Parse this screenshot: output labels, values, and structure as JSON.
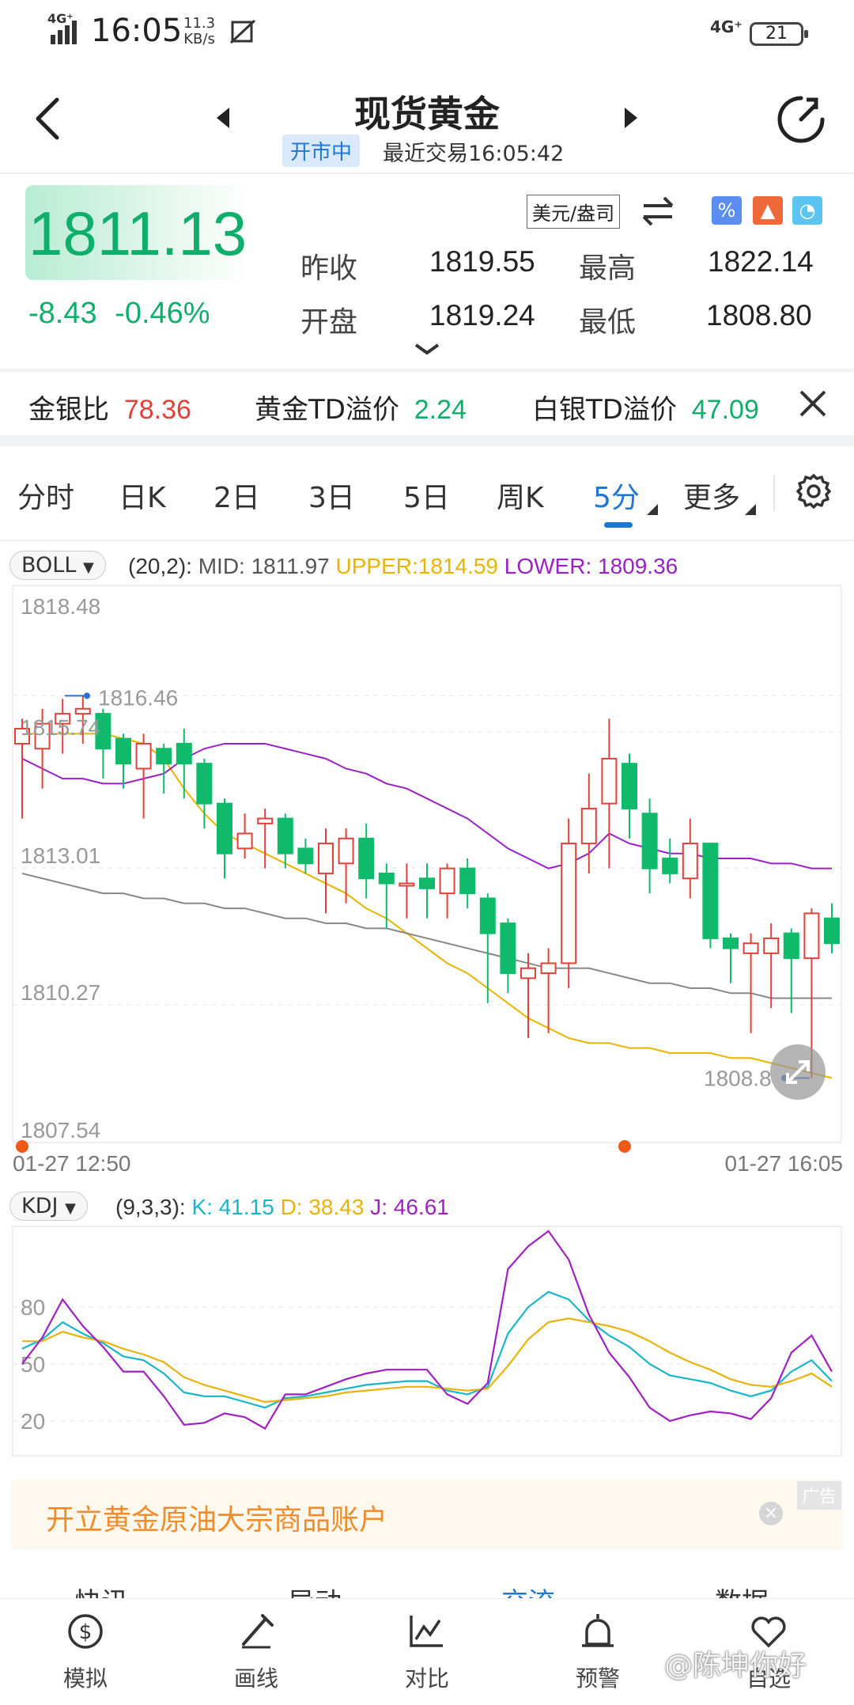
{
  "status_bar": {
    "network_left": "4G⁺",
    "time": "16:05",
    "speed_value": "11.3",
    "speed_unit": "KB/s",
    "network_right": "4G⁺",
    "battery": "21"
  },
  "header": {
    "title": "现货黄金",
    "status_badge": "开市中",
    "last_trade": "最近交易16:05:42"
  },
  "quote": {
    "price": "1811.13",
    "change": "-8.43",
    "change_pct": "-0.46%",
    "currency": "美元/盎司",
    "prev_close_label": "昨收",
    "prev_close": "1819.55",
    "high_label": "最高",
    "high": "1822.14",
    "open_label": "开盘",
    "open": "1819.24",
    "low_label": "最低",
    "low": "1808.80"
  },
  "ratios": [
    {
      "label": "金银比",
      "value": "78.36",
      "color": "#e0423a"
    },
    {
      "label": "黄金TD溢价",
      "value": "2.24",
      "color": "#0fae6a"
    },
    {
      "label": "白银TD溢价",
      "value": "47.09",
      "color": "#0fae6a"
    }
  ],
  "tabs": [
    "分时",
    "日K",
    "2日",
    "3日",
    "5日",
    "周K",
    "5分",
    "更多"
  ],
  "active_tab": "5分",
  "boll": {
    "name": "BOLL",
    "params": "(20,2):",
    "mid": "MID: 1811.97",
    "upper": "UPPER:1814.59",
    "lower": "LOWER: 1809.36"
  },
  "kdj": {
    "name": "KDJ",
    "params": "(9,3,3):",
    "k": "K: 41.15",
    "d": "D: 38.43",
    "j": "J: 46.61"
  },
  "colors": {
    "up": "#e0423a",
    "down": "#0fba6a",
    "upper": "#e9b400",
    "lower": "#9b20c8",
    "mid": "#888888",
    "k": "#1ab5c8",
    "d": "#e8b30c",
    "j": "#a020c0"
  },
  "chart_data": [
    {
      "type": "candlestick",
      "title": "",
      "y_ticks": [
        "1818.48",
        "1813.01",
        "1810.27",
        "1807.54"
      ],
      "ylim": [
        1807.54,
        1818.48
      ],
      "x_labels": [
        "01-27 12:50",
        "01-27 16:05"
      ],
      "annotations": [
        "1816.46",
        "1815.74",
        "1808.8"
      ],
      "candles": [
        {
          "o": 1815.5,
          "h": 1816.0,
          "l": 1814.0,
          "c": 1815.8
        },
        {
          "o": 1815.4,
          "h": 1816.2,
          "l": 1814.6,
          "c": 1815.9
        },
        {
          "o": 1815.9,
          "h": 1816.4,
          "l": 1815.3,
          "c": 1816.1
        },
        {
          "o": 1816.1,
          "h": 1816.46,
          "l": 1815.5,
          "c": 1816.2
        },
        {
          "o": 1816.1,
          "h": 1816.2,
          "l": 1814.8,
          "c": 1815.4
        },
        {
          "o": 1815.6,
          "h": 1815.7,
          "l": 1814.6,
          "c": 1815.1
        },
        {
          "o": 1815.0,
          "h": 1815.7,
          "l": 1814.0,
          "c": 1815.5
        },
        {
          "o": 1815.4,
          "h": 1815.5,
          "l": 1814.5,
          "c": 1815.1
        },
        {
          "o": 1815.5,
          "h": 1815.8,
          "l": 1814.4,
          "c": 1815.1
        },
        {
          "o": 1815.1,
          "h": 1815.2,
          "l": 1813.8,
          "c": 1814.3
        },
        {
          "o": 1814.3,
          "h": 1814.4,
          "l": 1812.8,
          "c": 1813.3
        },
        {
          "o": 1813.4,
          "h": 1814.1,
          "l": 1813.2,
          "c": 1813.7
        },
        {
          "o": 1813.9,
          "h": 1814.2,
          "l": 1813.0,
          "c": 1814.0
        },
        {
          "o": 1814.0,
          "h": 1814.1,
          "l": 1813.0,
          "c": 1813.3
        },
        {
          "o": 1813.4,
          "h": 1813.6,
          "l": 1812.9,
          "c": 1813.1
        },
        {
          "o": 1812.9,
          "h": 1813.8,
          "l": 1812.1,
          "c": 1813.5
        },
        {
          "o": 1813.1,
          "h": 1813.8,
          "l": 1812.3,
          "c": 1813.6
        },
        {
          "o": 1813.6,
          "h": 1813.9,
          "l": 1812.4,
          "c": 1812.8
        },
        {
          "o": 1812.9,
          "h": 1813.1,
          "l": 1811.8,
          "c": 1812.7
        },
        {
          "o": 1812.7,
          "h": 1813.1,
          "l": 1812.0,
          "c": 1812.7
        },
        {
          "o": 1812.8,
          "h": 1813.1,
          "l": 1812.0,
          "c": 1812.6
        },
        {
          "o": 1812.5,
          "h": 1813.1,
          "l": 1812.0,
          "c": 1813.0
        },
        {
          "o": 1813.0,
          "h": 1813.2,
          "l": 1812.2,
          "c": 1812.5
        },
        {
          "o": 1812.4,
          "h": 1812.5,
          "l": 1810.3,
          "c": 1811.7
        },
        {
          "o": 1811.9,
          "h": 1812.0,
          "l": 1810.5,
          "c": 1810.9
        },
        {
          "o": 1810.8,
          "h": 1811.3,
          "l": 1809.6,
          "c": 1811.0
        },
        {
          "o": 1810.9,
          "h": 1811.4,
          "l": 1809.7,
          "c": 1811.1
        },
        {
          "o": 1811.1,
          "h": 1814.0,
          "l": 1810.6,
          "c": 1813.5
        },
        {
          "o": 1813.5,
          "h": 1814.9,
          "l": 1812.9,
          "c": 1814.2
        },
        {
          "o": 1814.3,
          "h": 1816.0,
          "l": 1813.0,
          "c": 1815.2
        },
        {
          "o": 1815.1,
          "h": 1815.3,
          "l": 1813.6,
          "c": 1814.2
        },
        {
          "o": 1814.1,
          "h": 1814.4,
          "l": 1812.5,
          "c": 1813.0
        },
        {
          "o": 1813.2,
          "h": 1813.6,
          "l": 1812.7,
          "c": 1812.9
        },
        {
          "o": 1812.8,
          "h": 1814.0,
          "l": 1812.4,
          "c": 1813.5
        },
        {
          "o": 1813.5,
          "h": 1813.5,
          "l": 1811.4,
          "c": 1811.6
        },
        {
          "o": 1811.6,
          "h": 1811.7,
          "l": 1810.7,
          "c": 1811.4
        },
        {
          "o": 1811.3,
          "h": 1811.7,
          "l": 1809.7,
          "c": 1811.5
        },
        {
          "o": 1811.3,
          "h": 1811.9,
          "l": 1810.2,
          "c": 1811.6
        },
        {
          "o": 1811.7,
          "h": 1811.8,
          "l": 1810.1,
          "c": 1811.2
        },
        {
          "o": 1811.2,
          "h": 1812.2,
          "l": 1808.8,
          "c": 1812.1
        },
        {
          "o": 1812.0,
          "h": 1812.3,
          "l": 1811.3,
          "c": 1811.5
        }
      ],
      "upper": [
        1815.2,
        1815.0,
        1814.8,
        1814.8,
        1814.7,
        1814.7,
        1814.8,
        1814.9,
        1815.2,
        1815.4,
        1815.5,
        1815.5,
        1815.5,
        1815.4,
        1815.3,
        1815.2,
        1815.0,
        1814.9,
        1814.7,
        1814.6,
        1814.4,
        1814.2,
        1814.0,
        1813.7,
        1813.4,
        1813.2,
        1813.0,
        1813.1,
        1813.3,
        1813.7,
        1813.5,
        1813.4,
        1813.3,
        1813.3,
        1813.2,
        1813.2,
        1813.2,
        1813.1,
        1813.1,
        1813.0,
        1813.0
      ],
      "mid": [
        1812.9,
        1812.8,
        1812.7,
        1812.6,
        1812.5,
        1812.5,
        1812.4,
        1812.4,
        1812.3,
        1812.3,
        1812.2,
        1812.2,
        1812.1,
        1812.0,
        1812.0,
        1811.9,
        1811.9,
        1811.8,
        1811.8,
        1811.7,
        1811.6,
        1811.5,
        1811.4,
        1811.3,
        1811.2,
        1811.1,
        1811.0,
        1811.0,
        1811.0,
        1810.9,
        1810.8,
        1810.7,
        1810.7,
        1810.6,
        1810.6,
        1810.5,
        1810.5,
        1810.4,
        1810.4,
        1810.4,
        1810.4
      ],
      "lower": [
        1815.7,
        1815.7,
        1815.7,
        1815.7,
        1815.7,
        1815.6,
        1815.5,
        1815.2,
        1814.6,
        1814.1,
        1813.7,
        1813.5,
        1813.3,
        1813.1,
        1812.9,
        1812.7,
        1812.5,
        1812.2,
        1812.0,
        1811.7,
        1811.4,
        1811.1,
        1810.9,
        1810.6,
        1810.3,
        1810.0,
        1809.8,
        1809.6,
        1809.5,
        1809.5,
        1809.4,
        1809.4,
        1809.3,
        1809.3,
        1809.3,
        1809.2,
        1809.2,
        1809.1,
        1809.0,
        1808.9,
        1808.8
      ]
    },
    {
      "type": "line",
      "title": "",
      "y_ticks": [
        "80",
        "50",
        "20"
      ],
      "ylim": [
        0,
        120
      ],
      "series": [
        {
          "name": "K",
          "values": [
            58,
            63,
            72,
            66,
            61,
            54,
            52,
            45,
            35,
            33,
            33,
            30,
            27,
            32,
            33,
            35,
            37,
            39,
            40,
            41,
            41,
            36,
            34,
            38,
            66,
            80,
            88,
            84,
            73,
            65,
            59,
            50,
            44,
            42,
            40,
            36,
            33,
            36,
            46,
            52,
            41
          ]
        },
        {
          "name": "D",
          "values": [
            62,
            62,
            67,
            64,
            62,
            58,
            55,
            51,
            43,
            39,
            36,
            33,
            30,
            31,
            32,
            33,
            35,
            36,
            37,
            38,
            38,
            37,
            36,
            37,
            49,
            63,
            72,
            74,
            72,
            70,
            67,
            62,
            56,
            51,
            47,
            42,
            39,
            38,
            41,
            45,
            38
          ]
        },
        {
          "name": "J",
          "values": [
            50,
            64,
            84,
            70,
            59,
            46,
            46,
            33,
            18,
            19,
            24,
            22,
            16,
            34,
            34,
            38,
            42,
            45,
            47,
            47,
            47,
            34,
            29,
            40,
            100,
            112,
            120,
            105,
            76,
            56,
            43,
            27,
            20,
            23,
            25,
            24,
            21,
            32,
            56,
            65,
            46
          ]
        }
      ]
    }
  ],
  "ad": {
    "text": "开立黄金原油大宗商品账户",
    "tag": "广告"
  },
  "sub_tabs": [
    "快讯",
    "异动",
    "交流",
    "数据"
  ],
  "bottom_nav": [
    "模拟",
    "画线",
    "对比",
    "预警",
    "自选"
  ],
  "watermark": "@陈坤你好"
}
